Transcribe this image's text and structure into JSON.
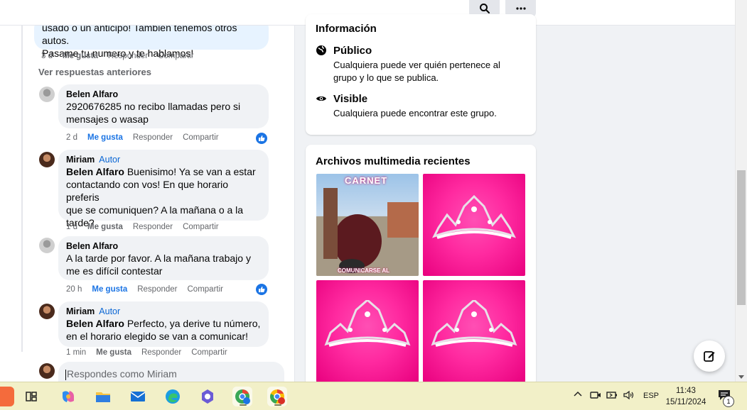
{
  "topbar": {
    "search_icon": "search-icon",
    "more_icon": "more-horizontal-icon"
  },
  "feed": {
    "first_comment": {
      "text_line1": "usado o un anticipo! También tenemos otros autos.",
      "text_line2": "Pasame tu numero y te hablamos!",
      "time": "3 d",
      "like": "Me gusta",
      "reply": "Responder",
      "share": "Compartir"
    },
    "previous_replies": "Ver respuestas anteriores",
    "comments": [
      {
        "author": "Belen Alfaro",
        "line1": "2920676285 no recibo llamadas pero si",
        "line2": "mensajes o wasap",
        "time": "2 d",
        "like": "Me gusta",
        "reply": "Responder",
        "share": "Compartir"
      },
      {
        "author": "Miriam",
        "badge": "Autor",
        "mention": "Belen Alfaro",
        "line1": " Buenisimo! Ya se van a estar",
        "line2": "contactando con vos! En que horario preferis",
        "line3": "que se comuniquen? A la mañana o a la",
        "line4": "tarde?",
        "time": "1 d",
        "like": "Me gusta",
        "reply": "Responder",
        "share": "Compartir"
      },
      {
        "author": "Belen Alfaro",
        "line1": "A la tarde por favor. A la mañana trabajo y",
        "line2": "me es difícil contestar",
        "time": "20 h",
        "like": "Me gusta",
        "reply": "Responder",
        "share": "Compartir"
      },
      {
        "author": "Miriam",
        "badge": "Autor",
        "mention": "Belen Alfaro",
        "line1": " Perfecto, ya derive tu número,",
        "line2": "en el horario elegido se van a comunicar!",
        "time": "1 min",
        "like": "Me gusta",
        "reply": "Responder",
        "share": "Compartir"
      }
    ],
    "reply_placeholder": "Respondes como Miriam"
  },
  "info_card": {
    "title": "Información",
    "items": [
      {
        "icon": "globe-icon",
        "heading": "Público",
        "line1": "Cualquiera puede ver quién pertenece al",
        "line2": "grupo y lo que se publica."
      },
      {
        "icon": "eye-icon",
        "heading": "Visible",
        "line1": "Cualquiera puede encontrar este grupo."
      }
    ]
  },
  "media_card": {
    "title": "Archivos multimedia recientes",
    "photo1_caption_top": "CARNET",
    "photo1_caption_bottom": "COMUNICARSE AL"
  },
  "taskbar": {
    "apps": [
      "copilot-icon",
      "task-view-icon",
      "file-explorer-icon",
      "mail-icon",
      "edge-icon",
      "copilot-app-icon",
      "chrome-profile-icon",
      "chrome-icon"
    ],
    "language": "ESP",
    "time": "11:43",
    "date": "15/11/2024",
    "notifications": "1"
  },
  "colors": {
    "accent": "#1b74e4",
    "author_badge": "#0a66d4",
    "taskbar": "#f2f0c8"
  }
}
